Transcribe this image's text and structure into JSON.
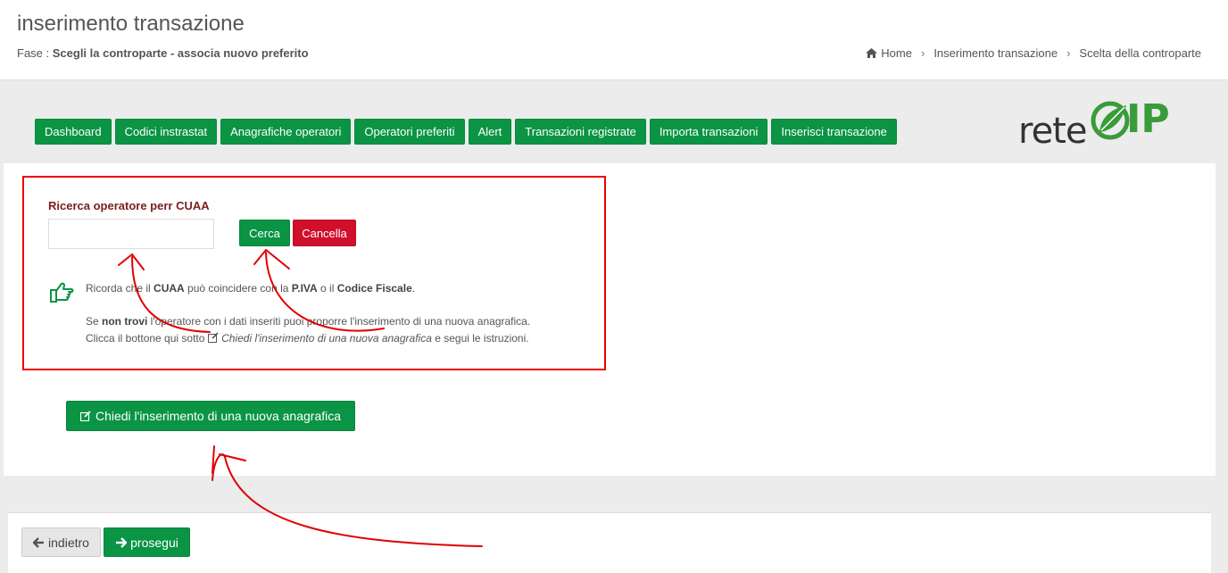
{
  "header": {
    "title": "inserimento transazione",
    "phase_prefix": "Fase :",
    "phase_value": "Scegli la controparte - associa nuovo preferito",
    "breadcrumb": [
      "Home",
      "Inserimento transazione",
      "Scelta della controparte"
    ]
  },
  "nav": {
    "items": [
      "Dashboard",
      "Codici instrastat",
      "Anagrafiche operatori",
      "Operatori preferiti",
      "Alert",
      "Transazioni registrate",
      "Importa transazioni",
      "Inserisci transazione"
    ]
  },
  "logo": {
    "text": "rete",
    "suffix": "IP"
  },
  "search": {
    "label": "Ricerca operatore perr CUAA",
    "input_value": "",
    "search_button": "Cerca",
    "cancel_button": "Cancella"
  },
  "info": {
    "line1_a": "Ricorda che il ",
    "line1_b": "CUAA",
    "line1_c": " può coincidere con la ",
    "line1_d": "P.IVA",
    "line1_e": " o il ",
    "line1_f": "Codice Fiscale",
    "line1_g": ".",
    "line2_a": "Se ",
    "line2_b": "non trovi",
    "line2_c": " l'operatore con i dati inseriti puoi proporre l'inserimento di una nuova anagrafica.",
    "line3_a": "Clicca il bottone qui sotto ",
    "line3_b": "Chiedi l'inserimento di una nuova anagrafica",
    "line3_c": " e segui le istruzioni."
  },
  "request_button": "Chiedi l'inserimento di una nuova anagrafica",
  "footer": {
    "back_button": "indietro",
    "next_button": "prosegui"
  },
  "colors": {
    "green": "#0a9444",
    "red": "#d0102b",
    "annotation": "#e00000"
  }
}
